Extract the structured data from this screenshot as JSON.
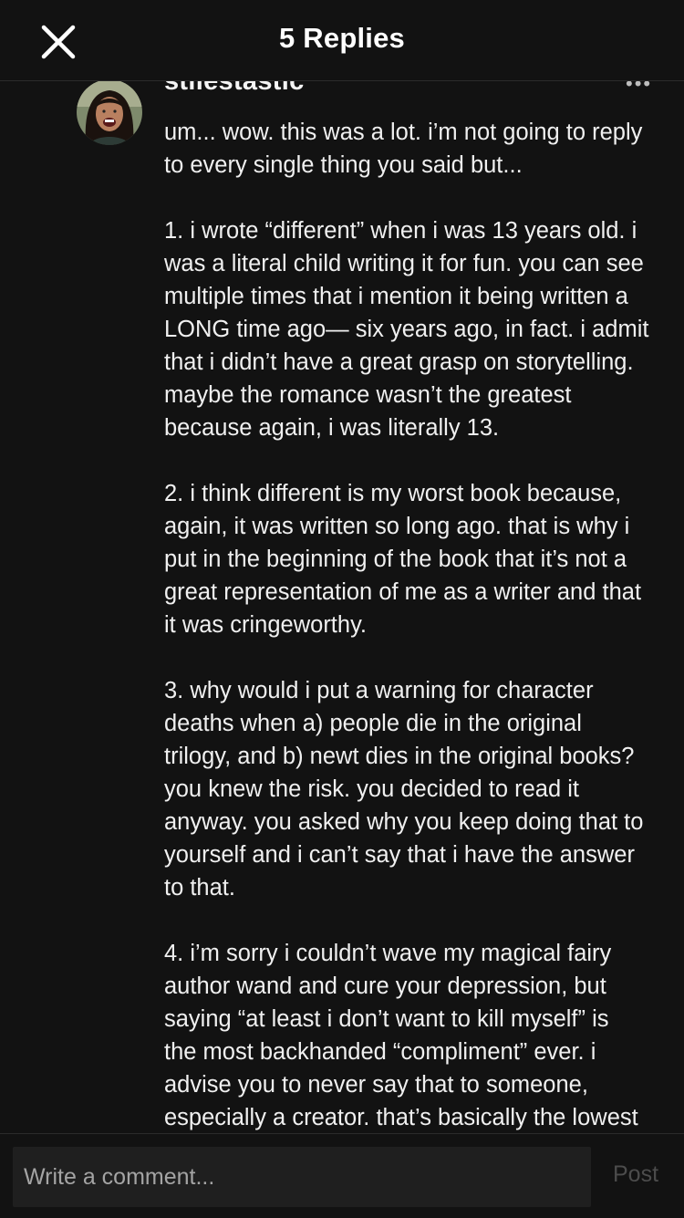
{
  "header": {
    "title": "5 Replies",
    "close_icon": "close-icon"
  },
  "comment": {
    "username": "stilestastic",
    "more_icon": "more-dots-icon",
    "more_label": "•••",
    "text": "um... wow. this was a lot. i’m not going to reply\nto every single thing you said but...\n\n1. i wrote “different” when i was 13 years old. i\nwas a literal child writing it for fun. you can see\nmultiple times that i mention it being written a\nLONG time ago— six years ago, in fact. i admit\nthat i didn’t have a great grasp on storytelling.\nmaybe the romance wasn’t the greatest\nbecause again, i was literally 13.\n\n2. i think different is my worst book because,\nagain, it was written so long ago. that is why i\nput in the beginning of the book that it’s not a\ngreat representation of me as a writer and that\nit was cringeworthy.\n\n3. why would i put a warning for character\ndeaths when a) people die in the original\ntrilogy, and b) newt dies in the original books?\nyou knew the risk. you decided to read it\nanyway. you asked why you keep doing that to\nyourself and i can’t say that i have the answer\nto that.\n\n4. i’m sorry i couldn’t wave my magical fairy\nauthor wand and cure your depression, but\nsaying “at least i don’t want to kill myself” is\nthe most backhanded “compliment” ever. i\nadvise you to never say that to someone,\nespecially a creator. that’s basically the lowest"
  },
  "footer": {
    "input_placeholder": "Write a comment...",
    "input_value": "",
    "post_label": "Post"
  },
  "colors": {
    "background": "#121212",
    "input_background": "#1f1f1f",
    "text": "#f0f0f0",
    "post_disabled": "#4c4c4c"
  }
}
